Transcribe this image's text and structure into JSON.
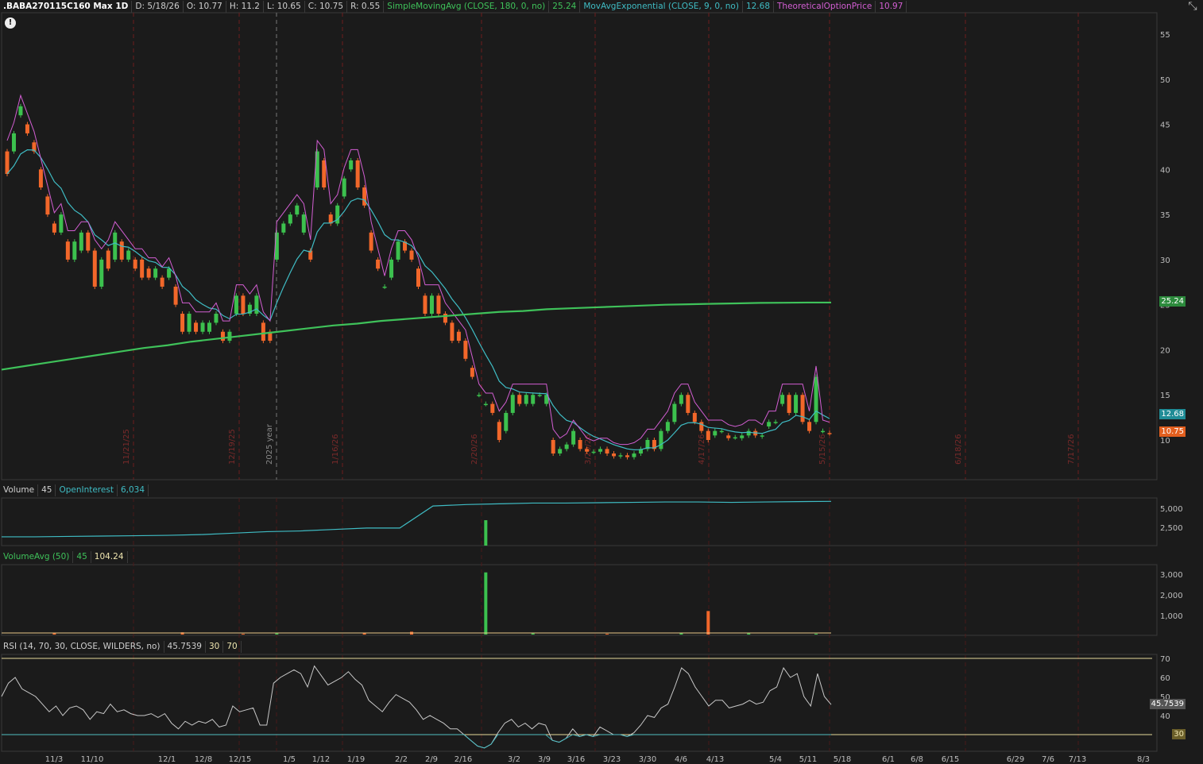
{
  "header": {
    "symbol": ".BABA270115C160 Max 1D",
    "date": "D: 5/18/26",
    "open": "O: 10.77",
    "high": "H: 11.2",
    "low": "L: 10.65",
    "close": "C: 10.75",
    "range": "R: 0.55",
    "sma_label": "SimpleMovingAvg (CLOSE, 180, 0, no)",
    "sma_value": "25.24",
    "ema_label": "MovAvgExponential (CLOSE, 9, 0, no)",
    "ema_value": "12.68",
    "top_label": "TheoreticalOptionPrice",
    "top_value": "10.97"
  },
  "price_badges": {
    "sma": "25.24",
    "ema": "12.68",
    "close": "10.75"
  },
  "volume_panel": {
    "label": "Volume",
    "value": "45",
    "oi_label": "OpenInterest",
    "oi_value": "6,034"
  },
  "volavg_panel": {
    "label": "VolumeAvg (50)",
    "value": "45",
    "avg": "104.24"
  },
  "rsi_panel": {
    "label": "RSI (14, 70, 30, CLOSE, WILDERS, no)",
    "value": "45.7539",
    "os": "30",
    "ob": "70",
    "badge": "45.7539",
    "os_badge": "30"
  },
  "colors": {
    "up": "#3cc14e",
    "down": "#f2672a",
    "sma": "#3fc25a",
    "ema": "#3fbcc4",
    "top": "#d35ed3",
    "bg": "#1b1b1b"
  },
  "chart_data": {
    "type": "candlestick",
    "price_axis": {
      "ticks": [
        "55",
        "50",
        "45",
        "40",
        "35",
        "30",
        "25",
        "20",
        "15",
        "10"
      ]
    },
    "x_ticks": [
      "11/3",
      "11/10",
      "12/1",
      "12/8",
      "12/15",
      "1/5",
      "1/12",
      "1/19",
      "2/2",
      "2/9",
      "2/16",
      "3/2",
      "3/9",
      "3/16",
      "3/23",
      "3/30",
      "4/6",
      "4/13",
      "5/4",
      "5/11",
      "5/18",
      "6/1",
      "6/8",
      "6/15",
      "6/29",
      "7/6",
      "7/13",
      "8/3"
    ],
    "vertical_markers": [
      "11/21/25",
      "12/19/25",
      "2025 year",
      "1/16/26",
      "2/20/26",
      "3/20/26",
      "4/17/26",
      "5/15/26",
      "6/18/26",
      "7/17/26"
    ],
    "close": [
      39.5,
      44,
      47,
      44,
      42,
      38,
      35,
      33,
      35,
      30,
      32,
      33,
      31,
      27,
      30,
      29,
      33,
      30,
      31,
      29,
      28,
      28,
      29,
      27,
      29,
      25,
      22,
      24,
      22,
      23,
      23,
      24,
      21,
      22,
      26,
      24,
      25,
      26,
      21,
      21,
      33,
      34,
      35,
      36,
      35,
      30,
      42,
      38,
      34,
      36,
      39,
      41,
      38,
      36,
      31,
      29,
      27,
      30,
      32,
      31,
      30,
      27,
      24,
      26,
      24,
      23,
      21,
      21,
      19,
      17,
      15,
      14,
      13,
      10,
      13,
      15,
      14,
      15,
      15,
      15,
      15,
      8.5,
      9,
      9.5,
      11,
      9,
      8.7,
      8.7,
      9,
      8.5,
      8.2,
      8.3,
      8.1,
      8.5,
      9,
      10,
      9,
      11,
      12,
      14,
      15,
      13,
      12,
      11,
      10,
      11,
      11,
      10.2,
      10.3,
      10.5,
      11,
      10.5,
      10.5,
      12,
      12,
      15,
      13,
      15,
      12,
      11,
      17,
      11,
      10.75
    ],
    "open": [
      42,
      42,
      46,
      45,
      43,
      40,
      37,
      34,
      33,
      32,
      30,
      31,
      33,
      31,
      27,
      31,
      30,
      32,
      30,
      30,
      30,
      29,
      28,
      28,
      28,
      27,
      24,
      22,
      23,
      22,
      22,
      23,
      22,
      21,
      24,
      26,
      24,
      24,
      23,
      22,
      30,
      33,
      34,
      35,
      33,
      31,
      38,
      41,
      35,
      34,
      37,
      40,
      41,
      38,
      33,
      30,
      27,
      28,
      30,
      32,
      31,
      29,
      26,
      24,
      26,
      24,
      23,
      22,
      21,
      18,
      15,
      14,
      14,
      12,
      11,
      13,
      15,
      14,
      14,
      15,
      14,
      10,
      8.5,
      9,
      9.5,
      10,
      9,
      8.7,
      8.7,
      9,
      8.5,
      8.2,
      8.3,
      8.1,
      8.5,
      9,
      10,
      9,
      11,
      12,
      14,
      15,
      13,
      12,
      11,
      10.5,
      11,
      10.5,
      10.3,
      10.2,
      10.5,
      11,
      10.4,
      11.5,
      12,
      14,
      15,
      13,
      15,
      12,
      12,
      11,
      10.77
    ],
    "sma": [
      17.8,
      18.2,
      18.6,
      19.0,
      19.4,
      19.8,
      20.2,
      20.5,
      20.9,
      21.2,
      21.5,
      21.8,
      22.1,
      22.4,
      22.7,
      22.9,
      23.2,
      23.4,
      23.6,
      23.8,
      24.0,
      24.2,
      24.3,
      24.5,
      24.6,
      24.7,
      24.8,
      24.9,
      25.0,
      25.05,
      25.1,
      25.15,
      25.2,
      25.22,
      25.24,
      25.24
    ],
    "rsi": [
      50,
      57,
      60,
      54,
      52,
      50,
      46,
      42,
      45,
      40,
      44,
      45,
      43,
      38,
      42,
      41,
      46,
      42,
      43,
      41,
      40,
      40,
      41,
      39,
      41,
      36,
      33,
      37,
      35,
      37,
      36,
      38,
      34,
      35,
      45,
      42,
      43,
      44,
      35,
      35,
      57,
      60,
      62,
      64,
      62,
      55,
      66,
      61,
      56,
      58,
      60,
      63,
      59,
      56,
      48,
      45,
      42,
      47,
      51,
      49,
      47,
      43,
      38,
      40,
      38,
      36,
      33,
      33,
      30,
      27,
      24,
      23,
      25,
      31,
      36,
      38,
      34,
      36,
      33,
      36,
      35,
      27,
      26,
      28,
      33,
      29,
      30,
      29,
      34,
      32,
      30,
      30,
      29,
      31,
      35,
      40,
      39,
      44,
      46,
      55,
      65,
      62,
      55,
      50,
      45,
      48,
      48,
      44,
      45,
      46,
      48,
      46,
      47,
      53,
      55,
      65,
      60,
      62,
      50,
      45,
      62,
      50,
      45.75
    ],
    "volume_bars_idx": [
      7,
      26,
      35,
      40,
      53,
      60,
      71,
      78,
      89,
      100,
      104,
      110,
      120
    ],
    "volume_bars_val": [
      80,
      120,
      40,
      60,
      90,
      150,
      3300,
      60,
      40,
      80,
      1250,
      60,
      45
    ],
    "open_interest": [
      1200,
      1200,
      1250,
      1300,
      1350,
      1400,
      1500,
      1700,
      1900,
      2000,
      2200,
      2400,
      2400,
      5400,
      5600,
      5700,
      5800,
      5800,
      5850,
      5900,
      5950,
      5950,
      5900,
      5950,
      6000,
      6034
    ],
    "rsi_levels": {
      "overbought": 70,
      "oversold": 30
    }
  }
}
